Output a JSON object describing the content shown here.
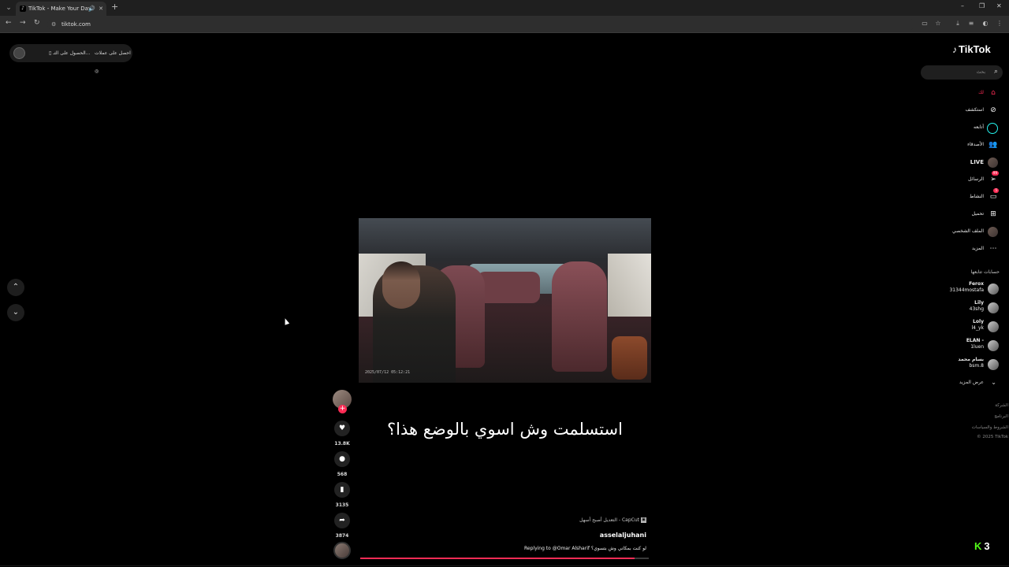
{
  "browser": {
    "tab_title": "TikTok - Make Your Day",
    "url": "tiktok.com"
  },
  "promo": {
    "item1": "احصل على عملات",
    "item2": "الحصول على التـ..."
  },
  "video": {
    "overlay_text": "استسلمت وش اسوي بالوضع هذا؟",
    "timestamp": "2025/07/12  05:12:21"
  },
  "actions": {
    "likes": "13.8K",
    "comments": "568",
    "saves": "3135",
    "shares": "3874"
  },
  "post": {
    "capcut_label": "CapCut - التعديل أصبح أسهل",
    "username": "asselaljuhani",
    "description": "Replying to @Omar Alsharif لو كنت بمكاني وش بتسوي؟",
    "progress_percent": 95
  },
  "sidebar": {
    "search_placeholder": "بحث",
    "nav": [
      {
        "label": "لك",
        "icon": "home-icon",
        "active": true
      },
      {
        "label": "استكشف",
        "icon": "compass-icon"
      },
      {
        "label": "أتابعه",
        "icon": "following-ring-icon"
      },
      {
        "label": "الأصدقاء",
        "icon": "friends-icon"
      },
      {
        "label": "LIVE",
        "icon": "live-icon"
      },
      {
        "label": "الرسائل",
        "icon": "messages-icon",
        "badge": "99"
      },
      {
        "label": "النشاط",
        "icon": "activity-icon",
        "badge": "5"
      },
      {
        "label": "تحميل",
        "icon": "upload-icon"
      },
      {
        "label": "الملف الشخصي",
        "icon": "profile-avatar-icon"
      },
      {
        "label": "المزيد",
        "icon": "more-icon"
      }
    ],
    "following_title": "حسابات تتابعها",
    "following": [
      {
        "name": "Ferox",
        "handle": "31344mostafa"
      },
      {
        "name": "Lily",
        "handle": "43shg"
      },
      {
        "name": "Loly",
        "handle": "l4_yk"
      },
      {
        "name": "ELAN -",
        "handle": "1luen"
      },
      {
        "name": "بسام محمد",
        "handle": "bsm.8"
      }
    ],
    "see_more": "عرض المزيد",
    "footer": [
      "الشركة",
      "البرنامج",
      "الشروط والسياسات",
      "© 2025 TikTok"
    ]
  },
  "overlay": {
    "kick_count": "3"
  },
  "colors": {
    "accent": "#fe2c55",
    "cyan": "#25f4ee",
    "kick_green": "#53fc18"
  }
}
